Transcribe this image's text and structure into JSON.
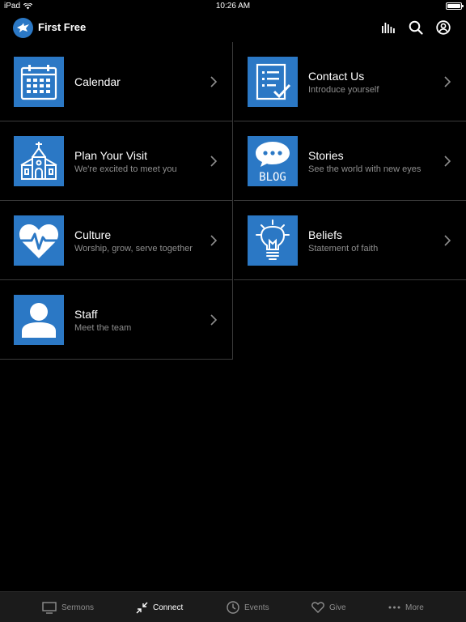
{
  "status_bar": {
    "device": "iPad",
    "time": "10:26 AM",
    "wifi_icon": "wifi-icon",
    "battery_icon": "battery-icon"
  },
  "header": {
    "title": "First Free",
    "logo_icon": "dove-logo-icon",
    "actions": [
      {
        "icon": "audio-bars-icon"
      },
      {
        "icon": "search-icon"
      },
      {
        "icon": "account-icon"
      }
    ]
  },
  "tiles": [
    {
      "title": "Calendar",
      "subtitle": "",
      "icon": "calendar-icon"
    },
    {
      "title": "Contact Us",
      "subtitle": "Introduce yourself",
      "icon": "form-check-icon"
    },
    {
      "title": "Plan Your Visit",
      "subtitle": "We're excited to meet you",
      "icon": "church-icon"
    },
    {
      "title": "Stories",
      "subtitle": "See the world with new eyes",
      "icon": "blog-bubble-icon",
      "icon_text": "BLOG"
    },
    {
      "title": "Culture",
      "subtitle": "Worship, grow, serve together",
      "icon": "heart-pulse-icon"
    },
    {
      "title": "Beliefs",
      "subtitle": "Statement of faith",
      "icon": "lightbulb-icon"
    },
    {
      "title": "Staff",
      "subtitle": "Meet the team",
      "icon": "person-icon"
    }
  ],
  "tabbar": {
    "items": [
      {
        "label": "Sermons",
        "icon": "monitor-icon",
        "active": false
      },
      {
        "label": "Connect",
        "icon": "connect-arrows-icon",
        "active": true
      },
      {
        "label": "Events",
        "icon": "clock-icon",
        "active": false
      },
      {
        "label": "Give",
        "icon": "heart-outline-icon",
        "active": false
      },
      {
        "label": "More",
        "icon": "more-dots-icon",
        "active": false
      }
    ]
  },
  "colors": {
    "background": "#000000",
    "tile_icon_bg": "#2b78c5",
    "divider": "#3a3a3a",
    "subtitle": "#8e8e8e",
    "tabbar_bg": "#1b1b1b"
  }
}
